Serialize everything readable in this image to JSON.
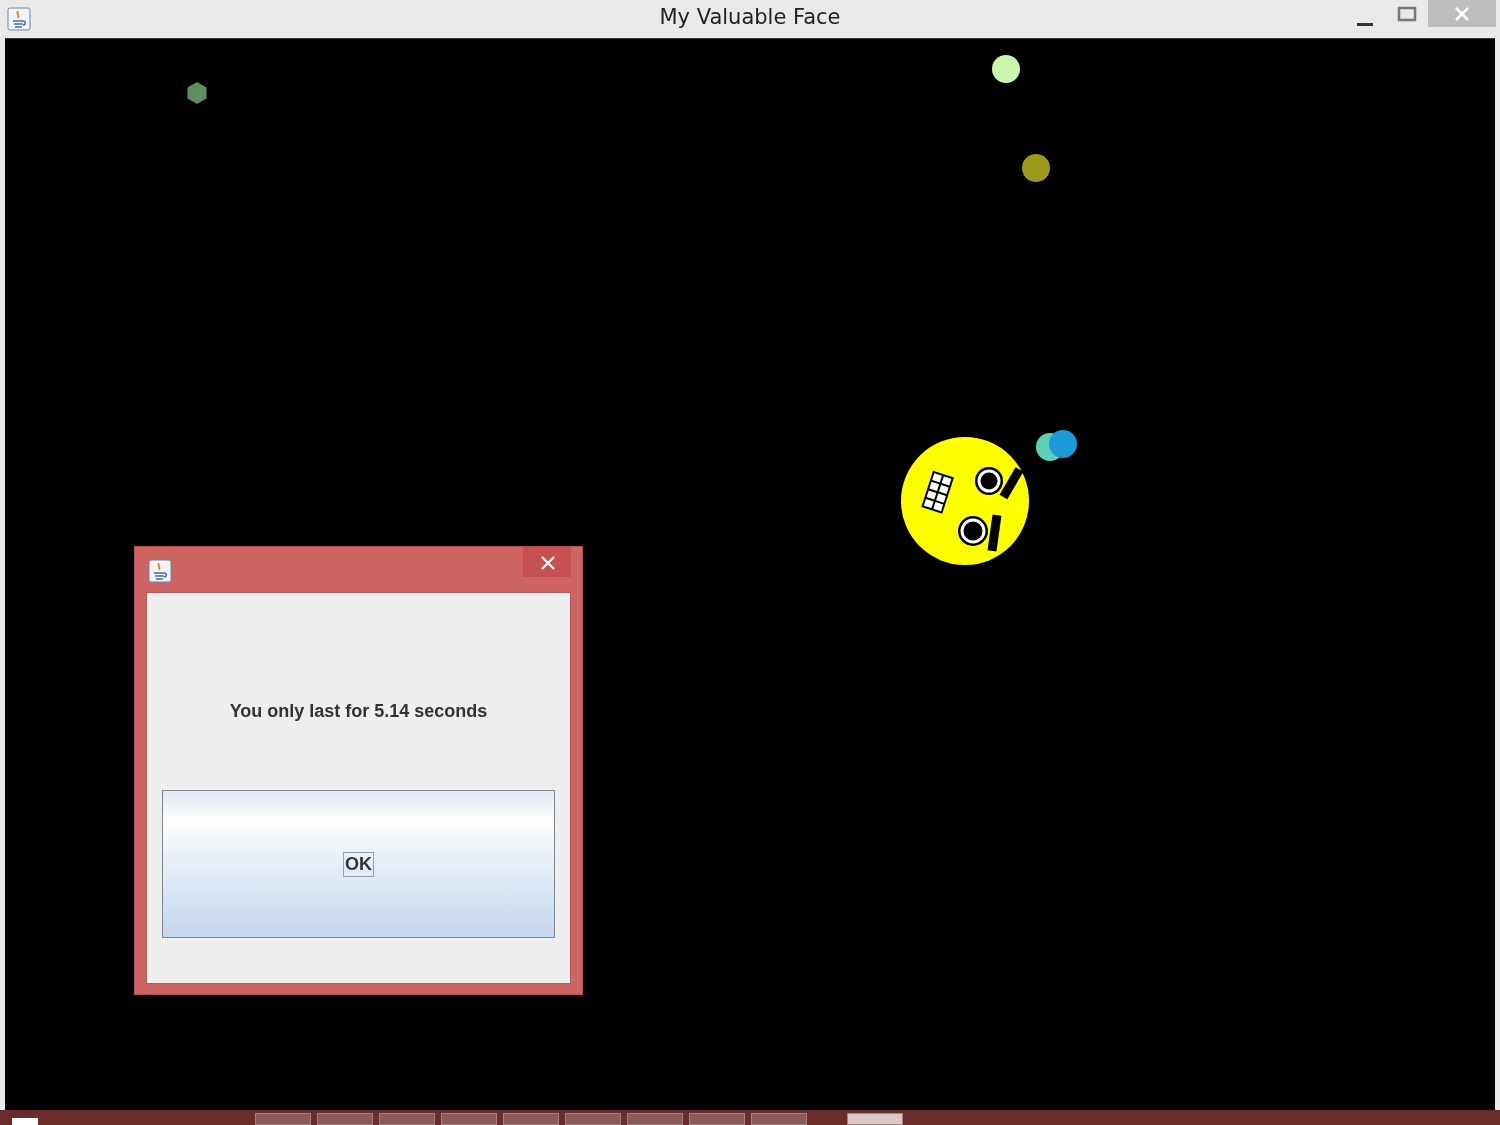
{
  "window": {
    "title": "My Valuable Face"
  },
  "balls": [
    {
      "color": "#5e8f5e"
    },
    {
      "color": "#c9f7a9"
    },
    {
      "color": "#9c9a1c"
    },
    {
      "color": "#5dcfb6"
    },
    {
      "color": "#1b9bd7"
    }
  ],
  "dialog": {
    "message": "You only last for 5.14 seconds",
    "button": "OK"
  }
}
